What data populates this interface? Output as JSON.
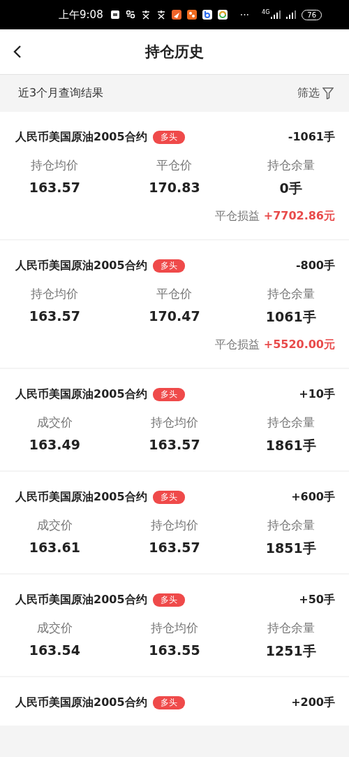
{
  "status_bar": {
    "time": "上午9:08",
    "more": "···",
    "network": "4G",
    "battery": "76"
  },
  "header": {
    "title": "持仓历史"
  },
  "filter_bar": {
    "summary": "近3个月查询结果",
    "filter_label": "筛选"
  },
  "records": [
    {
      "name": "人民币美国原油2005合约",
      "tag": "多头",
      "quantity": "-1061手",
      "fields": [
        {
          "label": "持仓均价",
          "value": "163.57"
        },
        {
          "label": "平仓价",
          "value": "170.83"
        },
        {
          "label": "持仓余量",
          "value": "0手"
        }
      ],
      "profit": {
        "label": "平仓损益",
        "value": "+7702.86元"
      }
    },
    {
      "name": "人民币美国原油2005合约",
      "tag": "多头",
      "quantity": "-800手",
      "fields": [
        {
          "label": "持仓均价",
          "value": "163.57"
        },
        {
          "label": "平仓价",
          "value": "170.47"
        },
        {
          "label": "持仓余量",
          "value": "1061手"
        }
      ],
      "profit": {
        "label": "平仓损益",
        "value": "+5520.00元"
      }
    },
    {
      "name": "人民币美国原油2005合约",
      "tag": "多头",
      "quantity": "+10手",
      "fields": [
        {
          "label": "成交价",
          "value": "163.49"
        },
        {
          "label": "持仓均价",
          "value": "163.57"
        },
        {
          "label": "持仓余量",
          "value": "1861手"
        }
      ]
    },
    {
      "name": "人民币美国原油2005合约",
      "tag": "多头",
      "quantity": "+600手",
      "fields": [
        {
          "label": "成交价",
          "value": "163.61"
        },
        {
          "label": "持仓均价",
          "value": "163.57"
        },
        {
          "label": "持仓余量",
          "value": "1851手"
        }
      ]
    },
    {
      "name": "人民币美国原油2005合约",
      "tag": "多头",
      "quantity": "+50手",
      "fields": [
        {
          "label": "成交价",
          "value": "163.54"
        },
        {
          "label": "持仓均价",
          "value": "163.55"
        },
        {
          "label": "持仓余量",
          "value": "1251手"
        }
      ]
    },
    {
      "name": "人民币美国原油2005合约",
      "tag": "多头",
      "quantity": "+200手"
    }
  ]
}
